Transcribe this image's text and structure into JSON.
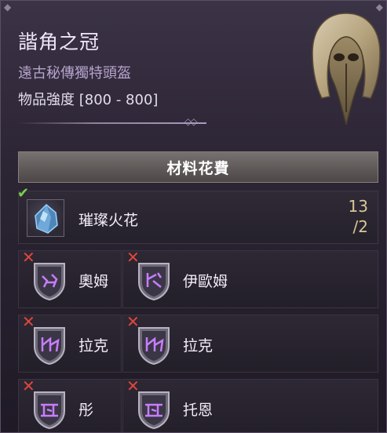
{
  "item": {
    "title": "諧角之冠",
    "type": "遠古秘傳獨特頭盔",
    "power": "物品強度 [800 - 800]"
  },
  "cost_header": "材料花費",
  "materials": [
    {
      "name": "璀璨火花",
      "owned": "13",
      "needed": "/2",
      "status": "check",
      "icon": "crystal-icon"
    }
  ],
  "runes": [
    {
      "name": "奧姆",
      "status": "cross",
      "icon": "rune-shield-icon"
    },
    {
      "name": "伊歐姆",
      "status": "cross",
      "icon": "rune-shield-icon"
    },
    {
      "name": "拉克",
      "status": "cross",
      "icon": "rune-shield-icon"
    },
    {
      "name": "拉克",
      "status": "cross",
      "icon": "rune-shield-icon"
    },
    {
      "name": "彤",
      "status": "cross",
      "icon": "rune-shield-icon"
    },
    {
      "name": "托恩",
      "status": "cross",
      "icon": "rune-shield-icon"
    }
  ],
  "colors": {
    "accent": "#b7a4cf",
    "check": "#7ad24a",
    "cross": "#e0463c",
    "count": "#d9c796"
  }
}
